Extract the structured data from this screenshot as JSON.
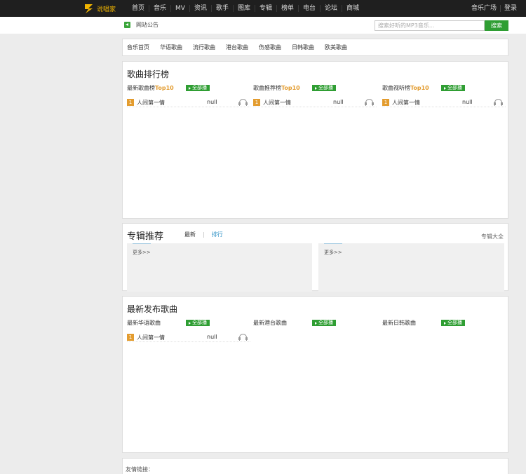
{
  "header": {
    "logo_text": "说唱家",
    "nav": [
      "首页",
      "音乐",
      "MV",
      "资讯",
      "歌手",
      "图库",
      "专辑",
      "榜单",
      "电台",
      "论坛",
      "商城"
    ],
    "right_links": [
      "音乐广场",
      "登录"
    ]
  },
  "notice": {
    "label": "网站公告",
    "search_placeholder": "搜索好听的MP3音乐...",
    "search_button": "搜索"
  },
  "categories": [
    "音乐首页",
    "华语歌曲",
    "流行歌曲",
    "港台歌曲",
    "伤感歌曲",
    "日韩歌曲",
    "欧美歌曲"
  ],
  "ranking": {
    "title": "歌曲排行榜",
    "all_label": "全部播",
    "columns": [
      {
        "prefix": "最新歌曲榜",
        "suffix": "Top10",
        "songs": [
          {
            "rank": "1",
            "name": "人间第一情",
            "artist": "null"
          }
        ]
      },
      {
        "prefix": "歌曲推荐榜",
        "suffix": "Top10",
        "songs": [
          {
            "rank": "1",
            "name": "人间第一情",
            "artist": "null"
          }
        ]
      },
      {
        "prefix": "歌曲视听榜",
        "suffix": "Top10",
        "songs": [
          {
            "rank": "1",
            "name": "人间第一情",
            "artist": "null"
          }
        ]
      }
    ]
  },
  "albums": {
    "title": "专辑推荐",
    "tab_new": "最新",
    "tab_sep": "|",
    "tab_rank": "排行",
    "all": "专辑大全",
    "more": "更多>>"
  },
  "latest": {
    "title": "最新发布歌曲",
    "all_label": "全部播",
    "columns": [
      {
        "label": "最新华语歌曲",
        "songs": [
          {
            "rank": "1",
            "name": "人间第一情",
            "artist": "null"
          }
        ]
      },
      {
        "label": "最新港台歌曲",
        "songs": []
      },
      {
        "label": "最新日韩歌曲",
        "songs": []
      }
    ]
  },
  "links": {
    "label": "友情链接："
  }
}
